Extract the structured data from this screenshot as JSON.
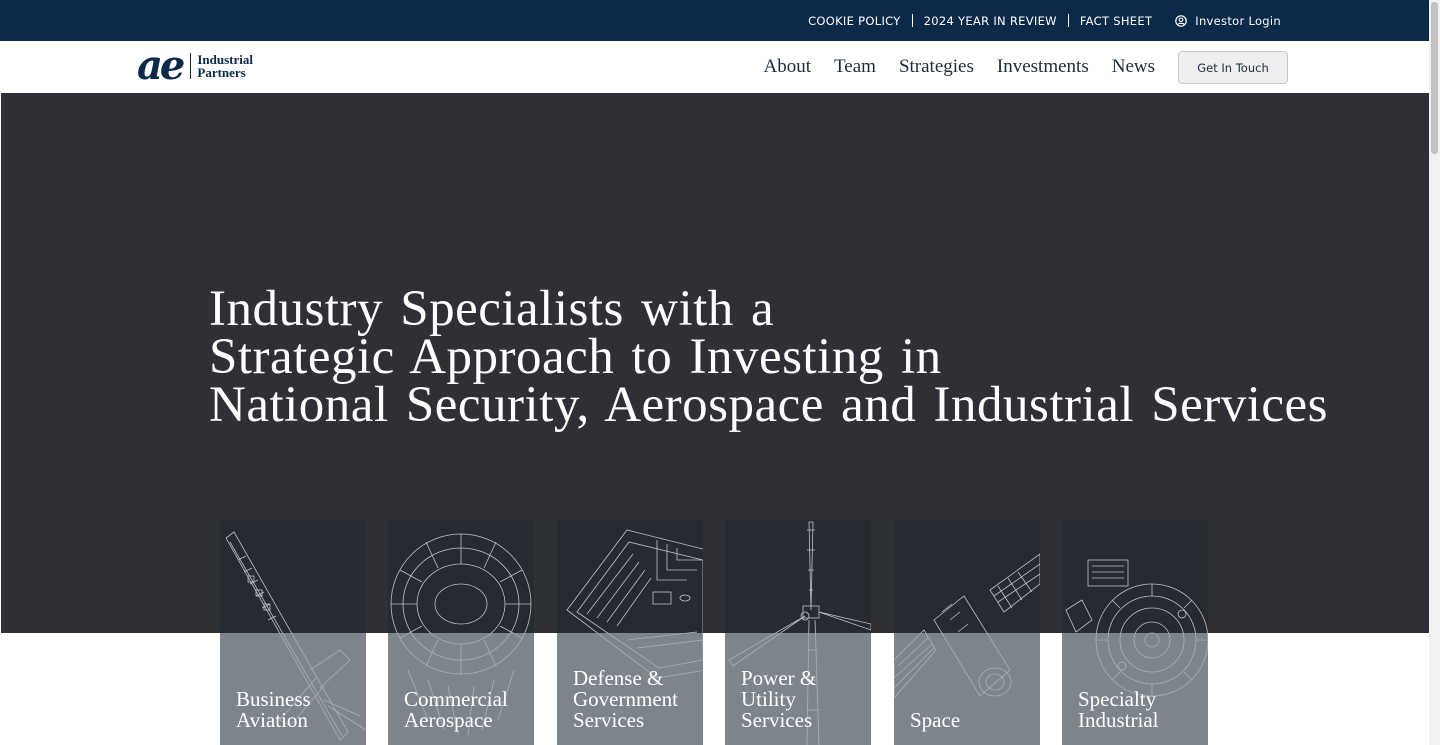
{
  "topbar": {
    "links": [
      "COOKIE POLICY",
      "2024 YEAR IN REVIEW",
      "FACT SHEET"
    ],
    "investor_login": "Investor Login"
  },
  "logo": {
    "mark": "ae",
    "line1": "Industrial",
    "line2": "Partners"
  },
  "nav": {
    "items": [
      "About",
      "Team",
      "Strategies",
      "Investments",
      "News"
    ],
    "cta": "Get In Touch"
  },
  "hero": {
    "headline_lines": [
      "Industry Specialists with a",
      "Strategic Approach to Investing in",
      "National Security, Aerospace and Industrial Services"
    ]
  },
  "cards": [
    {
      "lines": [
        "Business",
        "Aviation"
      ],
      "icon": "aircraft-icon"
    },
    {
      "lines": [
        "Commercial",
        "Aerospace"
      ],
      "icon": "turbine-engine-icon"
    },
    {
      "lines": [
        "Defense &",
        "Government",
        "Services"
      ],
      "icon": "circuit-board-icon"
    },
    {
      "lines": [
        "Power &",
        "Utility",
        "Services"
      ],
      "icon": "wind-turbine-icon"
    },
    {
      "lines": [
        "Space"
      ],
      "icon": "satellite-icon"
    },
    {
      "lines": [
        "Specialty",
        "Industrial"
      ],
      "icon": "machinery-icon"
    }
  ],
  "colors": {
    "topbar_bg": "#0b2a4a",
    "hero_bg": "#2e3036",
    "card_bg": "#262a31"
  }
}
